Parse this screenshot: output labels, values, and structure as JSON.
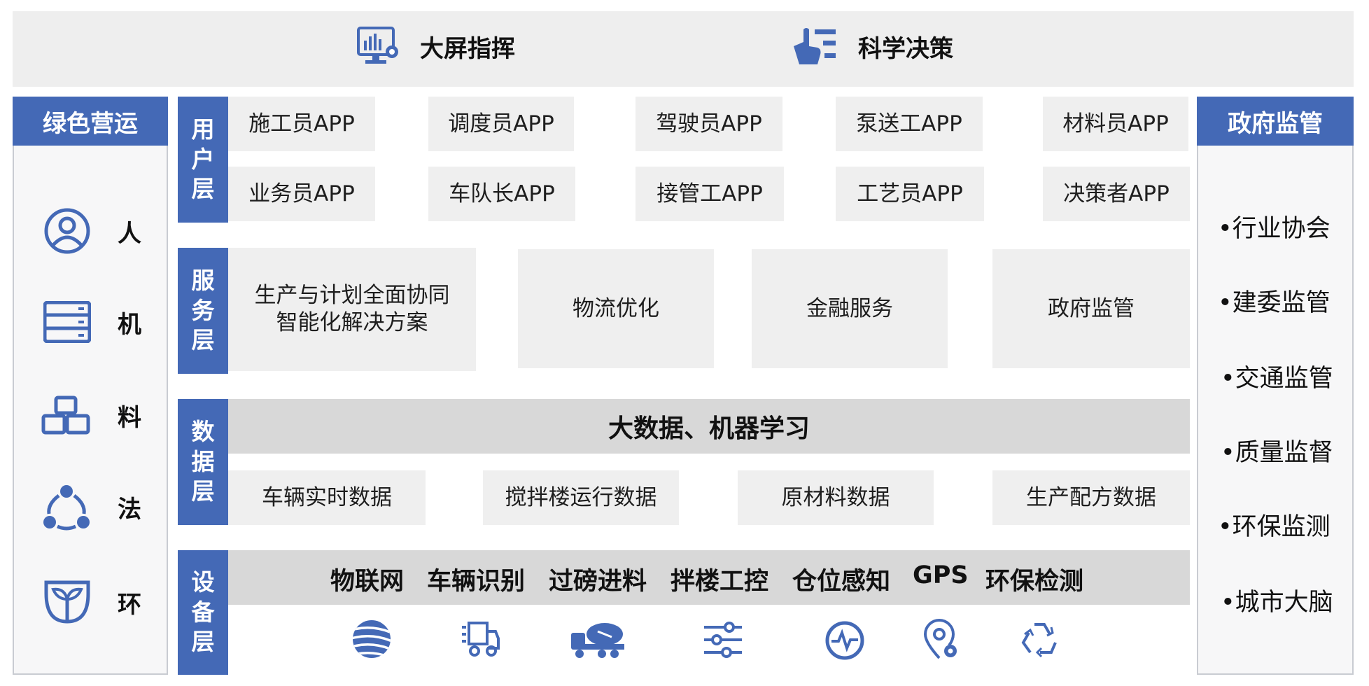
{
  "top": {
    "big_screen": "大屏指挥",
    "decision": "科学决策"
  },
  "left_panel": {
    "title": "绿色营运",
    "items": [
      {
        "label": "人",
        "icon": "person-icon"
      },
      {
        "label": "机",
        "icon": "server-icon"
      },
      {
        "label": "料",
        "icon": "material-stack-icon"
      },
      {
        "label": "法",
        "icon": "method-cycle-icon"
      },
      {
        "label": "环",
        "icon": "sprout-icon"
      }
    ]
  },
  "right_panel": {
    "title": "政府监管",
    "items": [
      "•行业协会",
      "•建委监管",
      "•交通监管",
      "•质量监督",
      "•环保监测",
      "•城市大脑"
    ]
  },
  "user_layer": {
    "tab": [
      "用",
      "户",
      "层"
    ],
    "apps_row1": [
      "施工员APP",
      "调度员APP",
      "驾驶员APP",
      "泵送工APP",
      "材料员APP"
    ],
    "apps_row2": [
      "业务员APP",
      "车队长APP",
      "接管工APP",
      "工艺员APP",
      "决策者APP"
    ]
  },
  "service_layer": {
    "tab": [
      "服",
      "务",
      "层"
    ],
    "items": [
      {
        "line1": "生产与计划全面协同",
        "line2": "智能化解决方案"
      },
      {
        "line1": "物流优化",
        "line2": ""
      },
      {
        "line1": "金融服务",
        "line2": ""
      },
      {
        "line1": "政府监管",
        "line2": ""
      }
    ]
  },
  "data_layer": {
    "tab": [
      "数",
      "据",
      "层"
    ],
    "banner": "大数据、机器学习",
    "items": [
      "车辆实时数据",
      "搅拌楼运行数据",
      "原材料数据",
      "生产配方数据"
    ]
  },
  "device_layer": {
    "tab": [
      "设",
      "备",
      "层"
    ],
    "labels": [
      "物联网",
      "车辆识别",
      "过磅进料",
      "拌楼工控",
      "仓位感知",
      "GPS",
      "环保检测"
    ],
    "icons": [
      "globe-icon",
      "truck-icon",
      "mixer-truck-icon",
      "sliders-icon",
      "pulse-icon",
      "location-gear-icon",
      "recycle-icon"
    ]
  },
  "colors": {
    "accent": "#4469b6",
    "box": "#efefef",
    "bar": "#d8d8d8",
    "top": "#eeeeee"
  }
}
